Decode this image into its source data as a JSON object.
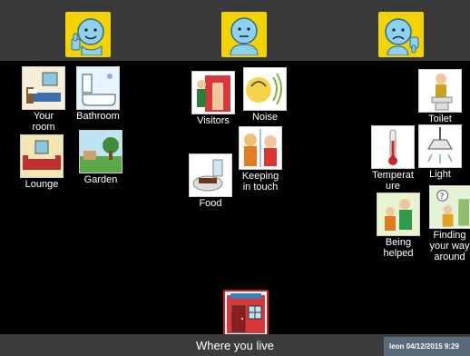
{
  "topbar": {
    "faces": [
      {
        "icon": "thumbs-up-face-icon"
      },
      {
        "icon": "neutral-face-icon"
      },
      {
        "icon": "thumbs-down-face-icon"
      }
    ]
  },
  "columns": {
    "left": [
      {
        "label": "Your\nroom",
        "icon": "bedroom-icon"
      },
      {
        "label": "Bathroom",
        "icon": "bathroom-icon"
      },
      {
        "label": "Lounge",
        "icon": "lounge-icon"
      },
      {
        "label": "Garden",
        "icon": "garden-icon"
      }
    ],
    "middle": [
      {
        "label": "Visitors",
        "icon": "visitors-icon"
      },
      {
        "label": "Noise",
        "icon": "noise-icon"
      },
      {
        "label": "Food",
        "icon": "food-icon"
      },
      {
        "label": "Keeping\nin touch",
        "icon": "phone-call-icon"
      }
    ],
    "right": [
      {
        "label": "Toilet",
        "icon": "toilet-icon"
      },
      {
        "label": "Temperat\nure",
        "icon": "thermometer-icon"
      },
      {
        "label": "Light",
        "icon": "ceiling-light-icon"
      },
      {
        "label": "Being\nhelped",
        "icon": "being-helped-icon"
      },
      {
        "label": "Finding\nyour way\naround",
        "icon": "finding-way-icon"
      }
    ]
  },
  "footer": {
    "title": "Where you live",
    "status": "leon  04/12/2015 9:29",
    "home_icon": "house-door-icon"
  },
  "colors": {
    "topbar": "#3a3a3a",
    "face_bg": "#f4d400",
    "background": "#000000",
    "home_border": "#c81e2a",
    "status_bg": "#5b6a7a"
  }
}
